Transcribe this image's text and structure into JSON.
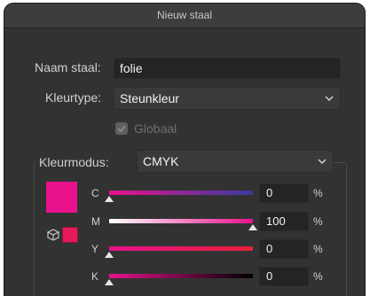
{
  "window": {
    "title": "Nieuw staal"
  },
  "swatch_name": {
    "label": "Naam staal:",
    "value": "folie"
  },
  "color_type": {
    "label": "Kleurtype:",
    "value": "Steunkleur"
  },
  "global": {
    "label": "Globaal",
    "checked": true,
    "disabled": true
  },
  "color_mode": {
    "label": "Kleurmodus:",
    "value": "CMYK"
  },
  "color": {
    "swatch": "#e8128c",
    "small_swatch": "#e81a5a"
  },
  "channels": [
    {
      "label": "C",
      "value": "0",
      "unit": "%",
      "fraction": 0.0
    },
    {
      "label": "M",
      "value": "100",
      "unit": "%",
      "fraction": 1.0
    },
    {
      "label": "Y",
      "value": "0",
      "unit": "%",
      "fraction": 0.0
    },
    {
      "label": "K",
      "value": "0",
      "unit": "%",
      "fraction": 0.0
    }
  ],
  "icons": [
    "checkbox-icon",
    "chevron-down-icon",
    "out-of-gamut-cube-icon"
  ]
}
